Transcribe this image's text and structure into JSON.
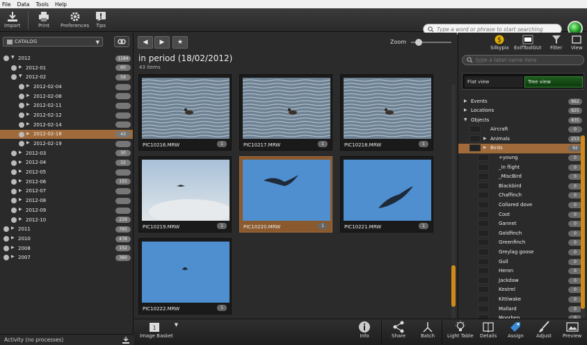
{
  "menu": [
    "File",
    "Data",
    "Tools",
    "Help"
  ],
  "toolbar": {
    "import": "Import",
    "print": "Print",
    "preferences": "Preferences",
    "tips": "Tips"
  },
  "search": {
    "placeholder": "Type a word or phrase to start searching"
  },
  "catalog": {
    "selector": "CATALOG"
  },
  "tree": [
    {
      "label": "2012",
      "count": "1184",
      "level": 0,
      "open": true
    },
    {
      "label": "2012-01",
      "count": "60",
      "level": 1
    },
    {
      "label": "2012-02",
      "count": "59",
      "level": 1,
      "open": true
    },
    {
      "label": "2012-02-04",
      "count": "",
      "level": 2
    },
    {
      "label": "2012-02-08",
      "count": "",
      "level": 2
    },
    {
      "label": "2012-02-11",
      "count": "",
      "level": 2
    },
    {
      "label": "2012-02-12",
      "count": "",
      "level": 2
    },
    {
      "label": "2012-02-14",
      "count": "",
      "level": 2
    },
    {
      "label": "2012-02-18",
      "count": "43",
      "level": 2,
      "selected": true
    },
    {
      "label": "2012-02-19",
      "count": "",
      "level": 2
    },
    {
      "label": "2012-03",
      "count": "30",
      "level": 1
    },
    {
      "label": "2012-04",
      "count": "32",
      "level": 1
    },
    {
      "label": "2012-05",
      "count": "",
      "level": 1
    },
    {
      "label": "2012-06",
      "count": "155",
      "level": 1
    },
    {
      "label": "2012-07",
      "count": "",
      "level": 1
    },
    {
      "label": "2012-08",
      "count": "",
      "level": 1
    },
    {
      "label": "2012-09",
      "count": "",
      "level": 1
    },
    {
      "label": "2012-10",
      "count": "229",
      "level": 1
    },
    {
      "label": "2011",
      "count": "765",
      "level": 0
    },
    {
      "label": "2010",
      "count": "478",
      "level": 0
    },
    {
      "label": "2008",
      "count": "152",
      "level": 0
    },
    {
      "label": "2007",
      "count": "360",
      "level": 0
    }
  ],
  "status": "Activity (no processes)",
  "center": {
    "period": "in period (18/02/2012)",
    "items": "43 items",
    "zoom_label": "Zoom",
    "zoom_value": "100"
  },
  "thumbs": [
    {
      "name": "PIC10216.MRW",
      "badge": "1",
      "scene": "water"
    },
    {
      "name": "PIC10217.MRW",
      "badge": "1",
      "scene": "water"
    },
    {
      "name": "PIC10218.MRW",
      "badge": "1",
      "scene": "water"
    },
    {
      "name": "PIC10219.MRW",
      "badge": "1",
      "scene": "cloud"
    },
    {
      "name": "PIC10220.MRW",
      "badge": "1",
      "scene": "sky",
      "selected": true
    },
    {
      "name": "PIC10221.MRW",
      "badge": "1",
      "scene": "sky"
    },
    {
      "name": "PIC10222.MRW",
      "badge": "1",
      "scene": "sky"
    }
  ],
  "right_tools": {
    "silkypix": "Silkypix",
    "exiftool": "ExifToolGUI",
    "filter": "Filter",
    "view": "View"
  },
  "label_search": {
    "placeholder": "type a label name here"
  },
  "view_tabs": {
    "flat": "Flat view",
    "tree": "Tree view"
  },
  "labels": [
    {
      "label": "Events",
      "count": "862",
      "level": 0
    },
    {
      "label": "Locations",
      "count": "825",
      "level": 0
    },
    {
      "label": "Objects",
      "count": "835",
      "level": 0,
      "open": true
    },
    {
      "label": "Aircraft",
      "count": "0",
      "level": 1
    },
    {
      "label": "Animals",
      "count": "253",
      "level": 1
    },
    {
      "label": "Birds",
      "count": "92",
      "level": 1,
      "selected": true
    },
    {
      "label": "+young",
      "count": "0",
      "level": 2
    },
    {
      "label": "_in flight",
      "count": "0",
      "level": 2
    },
    {
      "label": "_MiscBird",
      "count": "0",
      "level": 2
    },
    {
      "label": "Blackbird",
      "count": "0",
      "level": 2
    },
    {
      "label": "Chaffinch",
      "count": "0",
      "level": 2
    },
    {
      "label": "Collared dove",
      "count": "0",
      "level": 2
    },
    {
      "label": "Coot",
      "count": "0",
      "level": 2
    },
    {
      "label": "Gannet",
      "count": "0",
      "level": 2
    },
    {
      "label": "Goldfinch",
      "count": "0",
      "level": 2
    },
    {
      "label": "Greenfinch",
      "count": "0",
      "level": 2
    },
    {
      "label": "Greylag goose",
      "count": "0",
      "level": 2
    },
    {
      "label": "Gull",
      "count": "0",
      "level": 2
    },
    {
      "label": "Heron",
      "count": "0",
      "level": 2
    },
    {
      "label": "Jackdaw",
      "count": "0",
      "level": 2
    },
    {
      "label": "Kestrel",
      "count": "0",
      "level": 2
    },
    {
      "label": "Kittiwake",
      "count": "0",
      "level": 2
    },
    {
      "label": "Mallard",
      "count": "0",
      "level": 2
    },
    {
      "label": "Moorhen",
      "count": "0",
      "level": 2
    }
  ],
  "bottom": {
    "basket": "Image Basket",
    "info": "Info",
    "share": "Share",
    "batch": "Batch",
    "lighttable": "Light Table",
    "details": "Details",
    "assign": "Assign",
    "adjust": "Adjust",
    "preview": "Preview"
  }
}
